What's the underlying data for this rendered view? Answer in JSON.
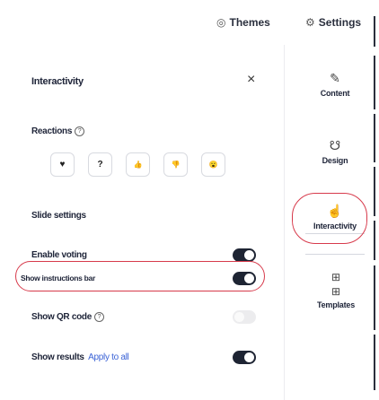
{
  "topbar": {
    "themes_label": "Themes",
    "themes_icon": "palette-icon",
    "settings_label": "Settings",
    "settings_icon": "gear-icon"
  },
  "panel": {
    "title": "Interactivity",
    "close_glyph": "×",
    "reactions_label": "Reactions",
    "reactions": [
      {
        "glyph": "♥",
        "name": "heart"
      },
      {
        "glyph": "?",
        "name": "question"
      },
      {
        "glyph": "👍",
        "name": "thumbs-up"
      },
      {
        "glyph": "👎",
        "name": "thumbs-down"
      },
      {
        "glyph": "😮",
        "name": "surprised"
      }
    ],
    "slide_settings_label": "Slide settings",
    "enable_voting_label": "Enable voting",
    "enable_voting_on": true,
    "show_instructions_label": "Show instructions bar",
    "show_instructions_on": true,
    "show_qr_label": "Show QR code",
    "show_qr_on": false,
    "show_results_label": "Show results",
    "apply_to_all_label": "Apply to all",
    "show_results_on": true
  },
  "nav": {
    "content_label": "Content",
    "design_label": "Design",
    "interactivity_label": "Interactivity",
    "templates_label": "Templates"
  },
  "colors": {
    "annotation": "#d73a4b",
    "toggle_on": "#1e2433",
    "link": "#3b63d6"
  }
}
